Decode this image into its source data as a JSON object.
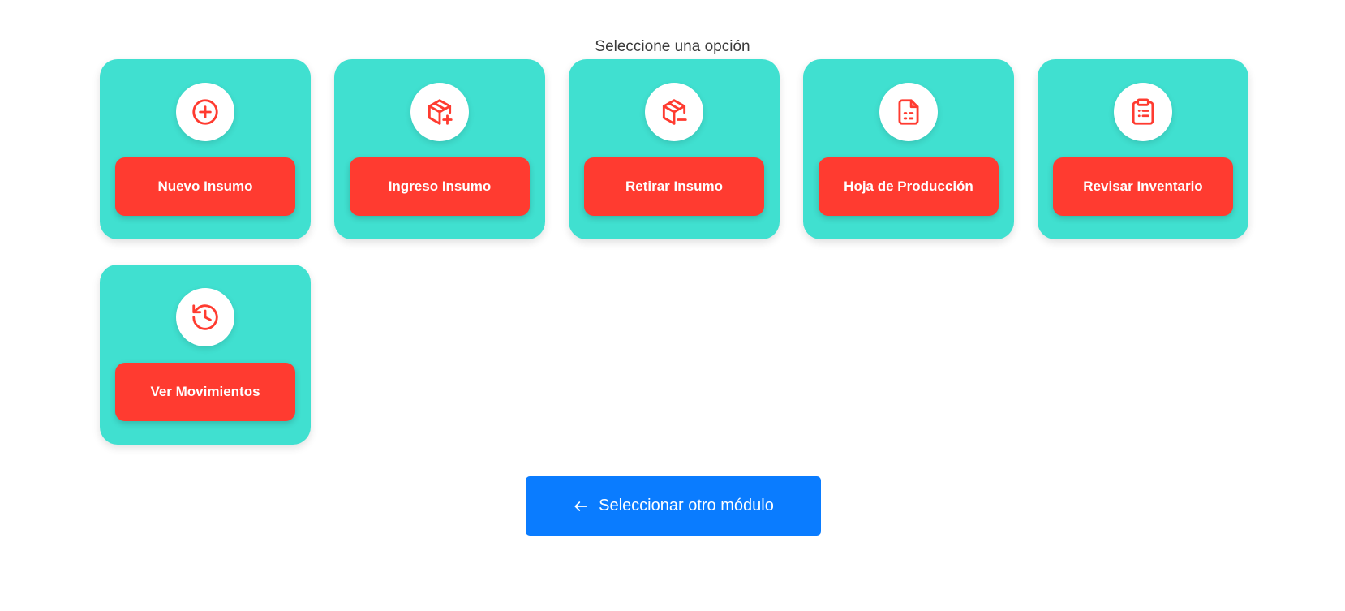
{
  "header": {
    "subtitle": "Seleccione una opción"
  },
  "options": [
    {
      "label": "Nuevo Insumo",
      "icon": "plus-circle-icon"
    },
    {
      "label": "Ingreso Insumo",
      "icon": "package-plus-icon"
    },
    {
      "label": "Retirar Insumo",
      "icon": "package-minus-icon"
    },
    {
      "label": "Hoja de Producción",
      "icon": "document-list-icon"
    },
    {
      "label": "Revisar Inventario",
      "icon": "clipboard-list-icon"
    },
    {
      "label": "Ver Movimientos",
      "icon": "history-icon"
    }
  ],
  "footer": {
    "back_label": "Seleccionar otro módulo",
    "back_icon": "arrow-left-icon"
  },
  "colors": {
    "card_bg": "#40e0d0",
    "button_bg": "#ff3b30",
    "icon_color": "#ff3b30",
    "back_button_bg": "#0a7cff"
  }
}
